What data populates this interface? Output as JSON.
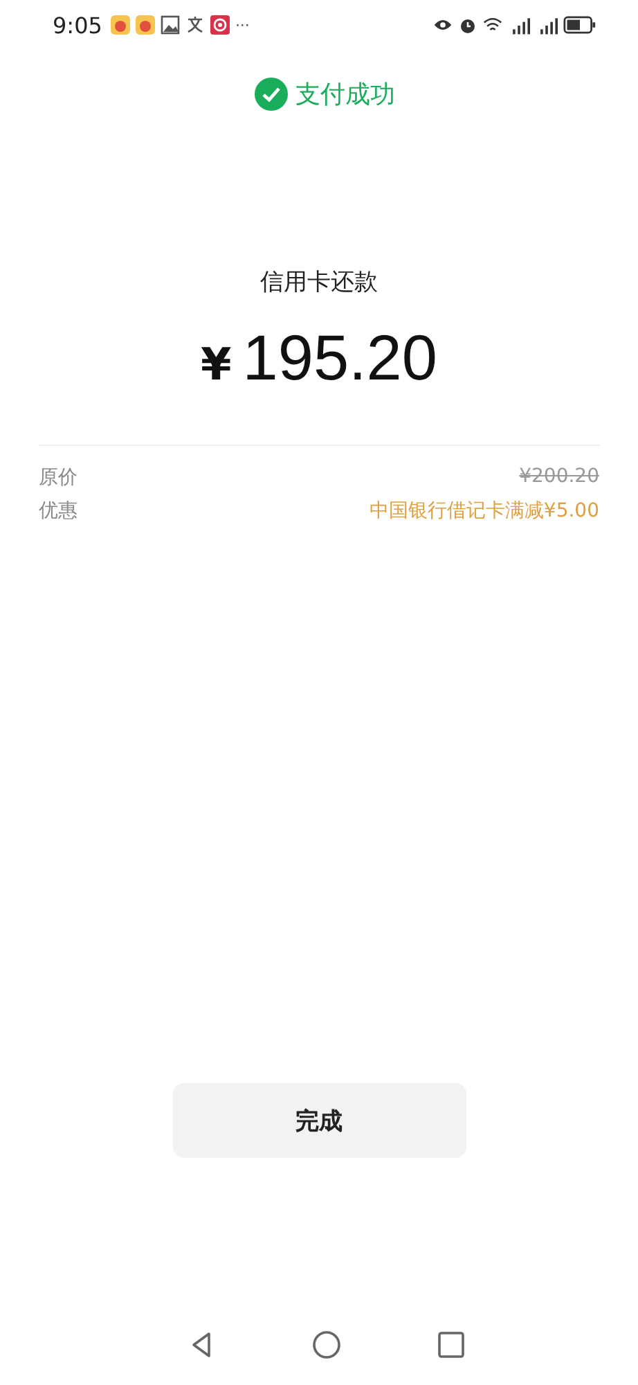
{
  "status_bar": {
    "time": "9:05",
    "more": "···"
  },
  "result": {
    "status": "支付成功",
    "title": "信用卡还款",
    "currency": "¥",
    "amount": "195.20"
  },
  "details": [
    {
      "label": "原价",
      "value": "¥200.20",
      "kind": "struck"
    },
    {
      "label": "优惠",
      "value": "中国银行借记卡满减¥5.00",
      "kind": "discount"
    }
  ],
  "done_button": "完成"
}
